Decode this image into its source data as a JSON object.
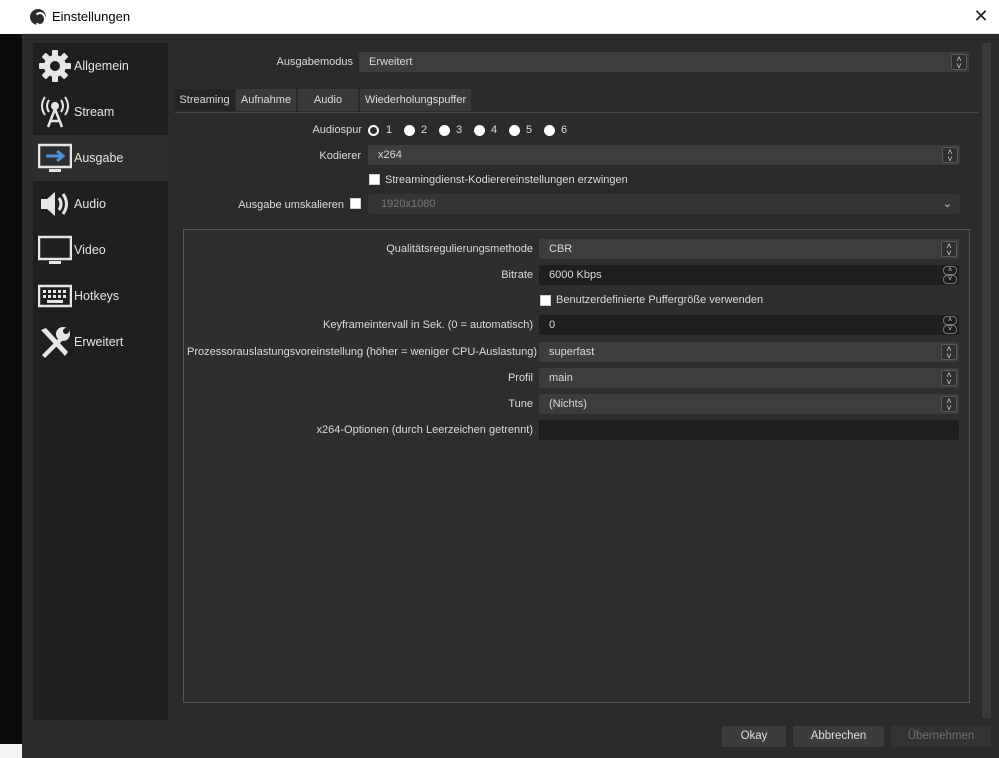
{
  "window": {
    "title": "Einstellungen"
  },
  "sidebar": {
    "items": [
      {
        "label": "Allgemein",
        "icon": "gear-icon"
      },
      {
        "label": "Stream",
        "icon": "broadcast-antenna-icon"
      },
      {
        "label": "Ausgabe",
        "icon": "monitor-output-icon",
        "active": true
      },
      {
        "label": "Audio",
        "icon": "speaker-icon"
      },
      {
        "label": "Video",
        "icon": "monitor-icon"
      },
      {
        "label": "Hotkeys",
        "icon": "keyboard-icon"
      },
      {
        "label": "Erweitert",
        "icon": "tools-icon"
      }
    ]
  },
  "output_mode": {
    "label": "Ausgabemodus",
    "value": "Erweitert"
  },
  "tabs": [
    {
      "label": "Streaming",
      "active": true
    },
    {
      "label": "Aufnahme"
    },
    {
      "label": "Audio"
    },
    {
      "label": "Wiederholungspuffer"
    }
  ],
  "streaming": {
    "audio_track": {
      "label": "Audiospur",
      "options": [
        "1",
        "2",
        "3",
        "4",
        "5",
        "6"
      ],
      "selected": "1"
    },
    "encoder": {
      "label": "Kodierer",
      "value": "x264"
    },
    "enforce_label": "Streamingdienst-Kodierereinstellungen erzwingen",
    "rescale": {
      "label": "Ausgabe umskalieren",
      "value": "1920x1080"
    },
    "rate_control": {
      "label": "Qualitätsregulierungsmethode",
      "value": "CBR"
    },
    "bitrate": {
      "label": "Bitrate",
      "value": "6000 Kbps"
    },
    "custom_buffer_label": "Benutzerdefinierte Puffergröße verwenden",
    "keyframe": {
      "label": "Keyframeintervall in Sek. (0 = automatisch)",
      "value": "0"
    },
    "cpu_preset": {
      "label": "Prozessorauslastungsvoreinstellung (höher = weniger CPU-Auslastung)",
      "value": "superfast"
    },
    "profile": {
      "label": "Profil",
      "value": "main"
    },
    "tune": {
      "label": "Tune",
      "value": "(Nichts)"
    },
    "x264_options": {
      "label": "x264-Optionen (durch Leerzeichen getrennt)",
      "value": ""
    }
  },
  "buttons": {
    "ok": "Okay",
    "cancel": "Abbrechen",
    "apply": "Übernehmen"
  }
}
